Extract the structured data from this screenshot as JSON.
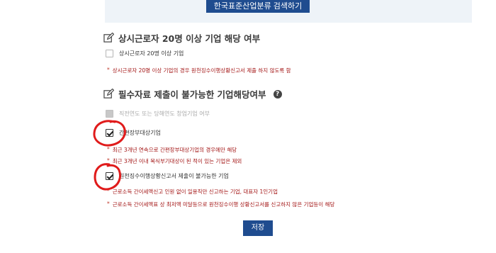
{
  "header": {
    "search_button": "한국표준산업분류 검색하기"
  },
  "section1": {
    "title": "상시근로자 20명 이상 기업 해당 여부",
    "checkbox_label": "상시근로자 20명 이상 기업",
    "note": "상시근로자 20명 이상 기업의 경우 원천징수이행상황신고서 제출 하지 않도록 함"
  },
  "section2": {
    "title": "필수자료 제출이 불가능한 기업해당여부",
    "help_icon": "?",
    "items": [
      {
        "label": "직전연도 또는 당해연도 창업기업 여부",
        "state": "disabled"
      },
      {
        "label": "간편장부대상기업",
        "state": "checked"
      },
      {
        "label": "원천징수이행상황신고서 제출이 불가능한 기업",
        "state": "checked"
      }
    ],
    "notes_item2": [
      "최근 3개년 연속으로 간편장부대상기업의 경우에만 해당",
      "최근 3개년 이내 복식부기대상이 된 적이 있는 기업은 제외"
    ],
    "notes_item3": [
      "근로소득 간이세액신고 인원 없이 일용직만 신고하는 기업, 대표자 1인기업",
      "근로소득 간이세액표 상 최저액 미달등으로 원천징수이행 상황신고서를 신고하지 않은 기업등이 해당"
    ]
  },
  "footer": {
    "save_button": "저장"
  },
  "colors": {
    "primary": "#1f4c8f",
    "note_red": "#a31515",
    "annotation_red": "#e01b1b"
  }
}
